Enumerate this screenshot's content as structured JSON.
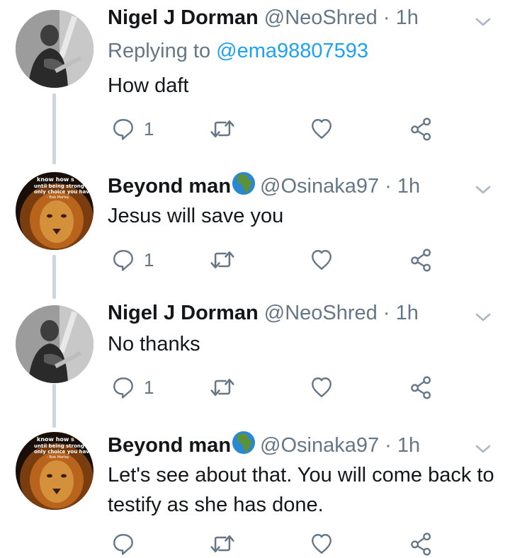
{
  "tweets": [
    {
      "name": "Nigel J Dorman",
      "handle": "@NeoShred",
      "sep": " · ",
      "time": "1h",
      "replying_prefix": "Replying to ",
      "replying_to": "@ema98807593",
      "text": "How daft",
      "reply_count": "1",
      "avatar": "guitarist-avatar"
    },
    {
      "name": "Beyond man",
      "handle": "@Osinaka97",
      "sep": " · ",
      "time": "1h",
      "text": "Jesus will save you",
      "reply_count": "1",
      "avatar": "lion-avatar"
    },
    {
      "name": "Nigel J Dorman",
      "handle": "@NeoShred",
      "sep": " · ",
      "time": "1h",
      "text": "No thanks",
      "reply_count": "1",
      "avatar": "guitarist-avatar"
    },
    {
      "name": "Beyond man",
      "handle": "@Osinaka97",
      "sep": " · ",
      "time": "1h",
      "text": "Let's see about that.  You will come back to testify as she has done.",
      "avatar": "lion-avatar"
    }
  ],
  "colors": {
    "name": "#14171a",
    "secondary": "#657786",
    "link": "#1da1f2",
    "thread_line": "#ccd6dd"
  },
  "icons": [
    "reply-icon",
    "retweet-icon",
    "like-icon",
    "share-icon",
    "chevron-down-icon",
    "globe-africa-icon"
  ]
}
